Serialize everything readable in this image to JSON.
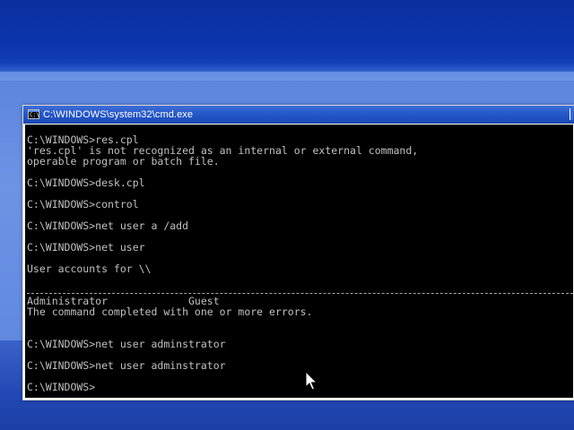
{
  "window": {
    "title": "C:\\WINDOWS\\system32\\cmd.exe",
    "icon": "cmd-icon",
    "icon_glyph": "C:\\"
  },
  "console": {
    "lines": [
      "C:\\WINDOWS>res.cpl",
      "'res.cpl' is not recognized as an internal or external command,",
      "operable program or batch file.",
      "",
      "C:\\WINDOWS>desk.cpl",
      "",
      "C:\\WINDOWS>control",
      "",
      "C:\\WINDOWS>net user a /add",
      "",
      "C:\\WINDOWS>net user",
      "",
      "User accounts for \\\\",
      "",
      "",
      "Administrator             Guest",
      "The command completed with one or more errors.",
      "",
      "",
      "C:\\WINDOWS>net user adminstrator",
      "",
      "C:\\WINDOWS>net user adminstrator",
      "",
      "C:\\WINDOWS>"
    ]
  },
  "colors": {
    "console_background": "#000000",
    "console_text": "#c0c0c0",
    "titlebar": "#2457c8",
    "desktop": "#3a67c8"
  },
  "cursor": {
    "icon": "mouse-pointer-icon"
  }
}
